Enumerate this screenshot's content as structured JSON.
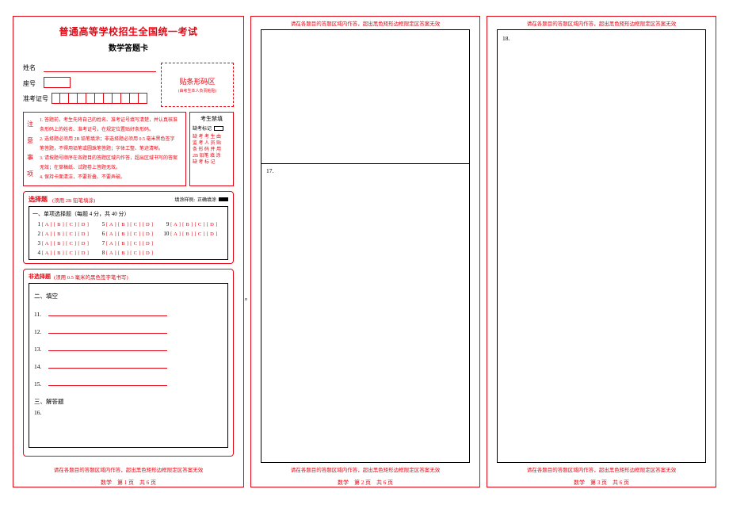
{
  "header": {
    "title": "普通高等学校招生全国统一考试",
    "subtitle": "数学答题卡"
  },
  "fields": {
    "name_label": "姓名",
    "seat_label": "座号",
    "ticket_label": "准考证号"
  },
  "barcode": {
    "title": "贴条形码区",
    "sub": "(由考生本人负责粘贴)"
  },
  "notice": {
    "side": "注意事项",
    "lines": {
      "l1a": "1. 答题前，考生先将自己的姓名、准考证号填写清楚，并认真核准",
      "l1b": "   条形码上的姓名、准考证号，在规定位置贴好条形码。",
      "l2a": "2. 选择题必须用 2B 铅笔填涂；非选择题必须用 0.5 毫米黑色签字",
      "l2b": "   笔答题，不得用铅笔或圆珠笔答题；字体工整、笔迹清晰。",
      "l3a": "3. 请按题号顺序在各题目的答题区域内作答，超出区域书写的答案",
      "l3b": "   无效；在草稿纸、试题卷上答题无效。",
      "l4": "4. 保持卡面清洁，不要折叠、不要弄破。"
    }
  },
  "forbid": {
    "title": "考生禁填",
    "absent": "缺考标记",
    "note": "缺 考 考 生 由\n监 考 人 员 贴\n条 形 码 并 用\n2B 铅笔 填 涂\n缺 考 标 记"
  },
  "choice": {
    "title": "选择题",
    "sub": "(须用 2B 铅笔填涂)",
    "demo_label": "填涂样例:",
    "demo_text": "正确填涂",
    "heading": "一、单项选择题（每题 4 分，共 40 分）",
    "opt": "[ A ] [ B ] [ C ] [ D ]"
  },
  "nonchoice": {
    "title": "非选择题",
    "sub": "(须用 0.5 毫米的黑色签字笔书写)",
    "fill_title": "二、填空",
    "q11": "11.",
    "q12": "12.",
    "q13": "13.",
    "q14": "14.",
    "q15": "15.",
    "essay_title": "三、解答题",
    "q16": "16."
  },
  "page2": {
    "q17": "17."
  },
  "page3": {
    "q18": "18."
  },
  "warn": "请在各题目的答题区域内作答，超出黑色矩形边框限定区答案无效",
  "footers": {
    "p1": "数学　第 1 页　共 6 页",
    "p2": "数学　第 2 页　共 6 页",
    "p3": "数学　第 3 页　共 6 页"
  }
}
